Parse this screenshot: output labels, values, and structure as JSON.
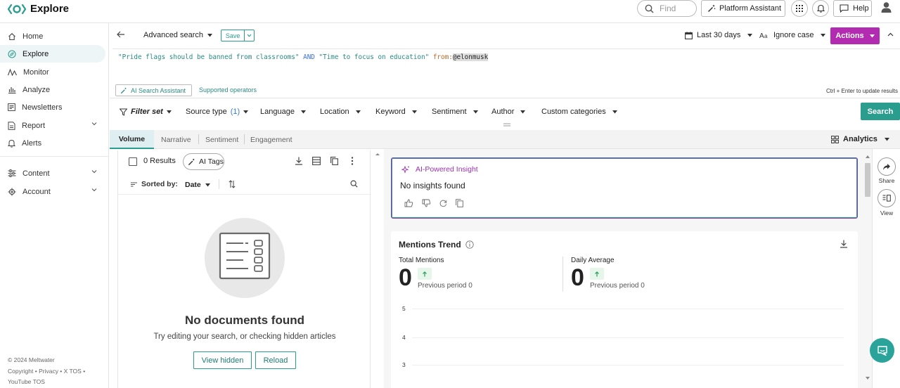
{
  "app": {
    "title": "Explore"
  },
  "topbar": {
    "find_placeholder": "Find",
    "platform_assistant": "Platform Assistant",
    "help": "Help"
  },
  "sidebar": {
    "items": [
      {
        "label": "Home",
        "icon": "home-icon"
      },
      {
        "label": "Explore",
        "icon": "compass-icon",
        "active": true
      },
      {
        "label": "Monitor",
        "icon": "pulse-icon"
      },
      {
        "label": "Analyze",
        "icon": "bar-chart-icon"
      },
      {
        "label": "Newsletters",
        "icon": "newsletter-icon"
      },
      {
        "label": "Report",
        "icon": "report-icon",
        "expandable": true
      },
      {
        "label": "Alerts",
        "icon": "bell-icon"
      },
      {
        "label": "Content",
        "icon": "sliders-icon",
        "expandable": true
      },
      {
        "label": "Account",
        "icon": "gear-icon",
        "expandable": true
      }
    ],
    "footer": {
      "copyright": "© 2024 Meltwater",
      "links": "Copyright • Privacy • X TOS •",
      "links2": "YouTube TOS"
    }
  },
  "search_header": {
    "title": "Advanced search",
    "save": "Save",
    "date_range": "Last 30 days",
    "case": "Ignore case",
    "actions": "Actions"
  },
  "query": {
    "part1": "\"Pride flags should be banned from classrooms\"",
    "op": "AND",
    "part2": "\"Time to focus on education\"",
    "from_kw": "from:",
    "handle": "@elonmusk"
  },
  "assist": {
    "ai_search": "AI Search Assistant",
    "supported_ops": "Supported operators",
    "hint": "Ctrl + Enter to update results"
  },
  "filters": {
    "filter_set": "Filter set",
    "source_type": "Source type",
    "source_type_count": "(1)",
    "language": "Language",
    "location": "Location",
    "keyword": "Keyword",
    "sentiment": "Sentiment",
    "author": "Author",
    "custom_categories": "Custom categories",
    "search": "Search"
  },
  "tabs": {
    "items": [
      "Volume",
      "Narrative",
      "Sentiment",
      "Engagement"
    ],
    "active": "Volume",
    "analytics": "Analytics"
  },
  "results": {
    "count_label": "0 Results",
    "ai_tags": "AI Tags",
    "sorted_by": "Sorted by:",
    "sort_value": "Date",
    "empty_title": "No documents found",
    "empty_sub": "Try editing your search, or checking hidden articles",
    "view_hidden": "View hidden",
    "reload": "Reload"
  },
  "insight": {
    "title": "AI-Powered Insight",
    "body": "No insights found"
  },
  "trend": {
    "title": "Mentions Trend",
    "total_label": "Total Mentions",
    "total_value": "0",
    "total_prev": "Previous period 0",
    "daily_label": "Daily Average",
    "daily_value": "0",
    "daily_prev": "Previous period 0",
    "y_ticks": [
      "5",
      "4",
      "3"
    ]
  },
  "rail": {
    "share": "Share",
    "view": "View"
  },
  "colors": {
    "brand_teal": "#2a9d8f",
    "actions_magenta": "#b32bb0",
    "insight_purple": "#9a32b0"
  }
}
